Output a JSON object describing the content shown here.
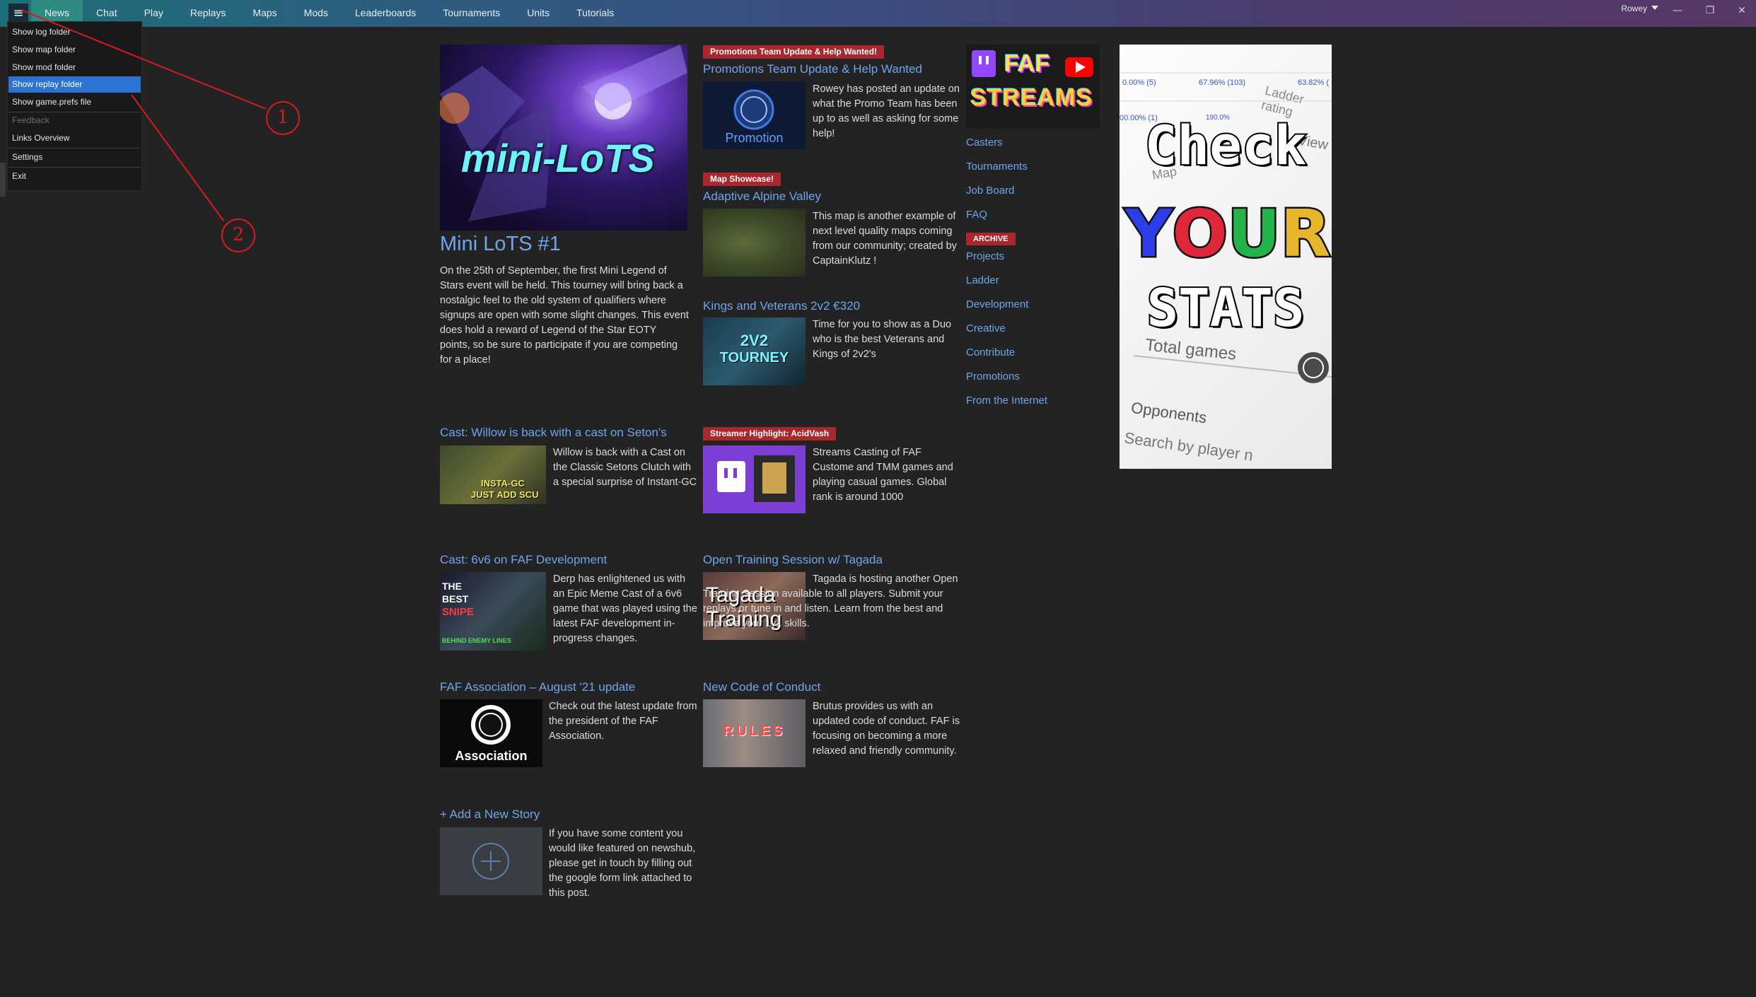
{
  "nav": {
    "menu_icon": "hamburger-icon",
    "menu_glyph": "≡",
    "tabs": [
      "News",
      "Chat",
      "Play",
      "Replays",
      "Maps",
      "Mods",
      "Leaderboards",
      "Tournaments",
      "Units",
      "Tutorials"
    ],
    "active_tab": "News",
    "user": "Rowey",
    "window_controls": {
      "minimize": "—",
      "restore": "❐",
      "close": "✕"
    }
  },
  "dropdown": {
    "items": [
      {
        "label": "Show log folder",
        "state": "normal"
      },
      {
        "label": "Show map folder",
        "state": "normal"
      },
      {
        "label": "Show mod folder",
        "state": "normal"
      },
      {
        "label": "Show replay folder",
        "state": "selected"
      },
      {
        "label": "Show game.prefs file",
        "state": "normal"
      },
      {
        "label": "Feedback",
        "state": "disabled"
      },
      {
        "label": "Links Overview",
        "state": "normal"
      },
      {
        "label": "Settings",
        "state": "normal"
      },
      {
        "label": "Exit",
        "state": "normal"
      }
    ]
  },
  "annotations": [
    "1",
    "2"
  ],
  "hero": {
    "image_text": "mini-LoTS",
    "title": "Mini LoTS #1",
    "text": "On the 25th of September, the first Mini Legend of Stars event will be held. This tourney will bring back a nostalgic feel to the old system of qualifiers where signups are open with some slight changes. This event does hold a reward of Legend of the Star EOTY points, so be sure to participate if you are competing for a place!"
  },
  "articles": {
    "promo": {
      "badge": "Promotions Team Update & Help Wanted!",
      "title": "Promotions Team Update & Help Wanted",
      "thumb_text": "Promotion",
      "text": "Rowey has posted an update on what the Promo Team has been up to as well as asking for some help!"
    },
    "map": {
      "badge": "Map Showcase!",
      "title": "Adaptive Alpine Valley",
      "text": "This map is another example of next level quality maps coming from our community; created by CaptainKlutz !"
    },
    "kings": {
      "title": "Kings and Veterans 2v2 €320",
      "thumb_text_1": "2V2",
      "thumb_text_2": "TOURNEY",
      "text": "Time for you to show as a Duo who is the best Veterans and Kings of 2v2's"
    },
    "willow": {
      "title": "Cast: Willow is back with a cast on Seton's",
      "thumb_text_1": "INSTA-GC",
      "thumb_text_2": "JUST ADD SCU",
      "text": "Willow is back with a Cast on the Classic Setons Clutch with a special surprise of Instant-GC"
    },
    "streamer": {
      "badge": "Streamer Highlight: AcidVash",
      "text": "Streams Casting of FAF Custome and TMM games and playing casual games. Global rank is around 1000"
    },
    "sixv6": {
      "title": "Cast: 6v6 on FAF Development",
      "thumb_text_1": "THE",
      "thumb_text_2": "BEST",
      "thumb_text_3": "SNIPE",
      "thumb_text_4": "BEHIND ENEMY LINES",
      "text": "Derp has enlightened us with an Epic Meme Cast of a 6v6 game that was played using the latest FAF development in-progress changes."
    },
    "tagada": {
      "title": "Open Training Session w/ Tagada",
      "thumb_text_1": "Tagada",
      "thumb_text_2": "Training",
      "text": "Tagada is hosting another Open Training Session available to all players. Submit your replays or tune in and listen. Learn from the best and improve your 1v1 skills."
    },
    "assoc": {
      "title": "FAF Association – August '21 update",
      "thumb_text": "Association",
      "text": "Check out the latest update from the president of the FAF Association."
    },
    "conduct": {
      "title": "New Code of Conduct",
      "thumb_text": "RULES",
      "text": "Brutus provides us with an updated code of conduct. FAF is focusing on becoming a more relaxed and friendly community."
    },
    "add": {
      "title": "+ Add a New Story",
      "text": "If you have some content you would like featured on newshub, please get in touch by filling out the google form link attached to this post."
    }
  },
  "sidebar": {
    "streams_line_1": "FAF",
    "streams_line_2": "STREAMS",
    "links_top": [
      "Casters",
      "Tournaments",
      "Job Board",
      "FAQ"
    ],
    "archive_badge": "ARCHIVE",
    "links_bottom": [
      "Projects",
      "Ladder",
      "Development",
      "Creative",
      "Contribute",
      "Promotions",
      "From the Internet"
    ]
  },
  "stats_banner": {
    "line_1": "Check",
    "line_2": [
      "Y",
      "O",
      "U",
      "R"
    ],
    "line_3": "STATS",
    "bg_texts": [
      "0.00% (5)",
      "67.96% (103)",
      "63.82% (",
      "00.00% (1)",
      "190.0%",
      "Ladder rating",
      "View",
      "Map",
      "Total games",
      "Opponents",
      "Search by player n"
    ]
  },
  "colors": {
    "link": "#6ea5ee",
    "badge": "#a8282e",
    "active_tab": "#2f8a82",
    "selected_item": "#2c73d2",
    "annotation": "#d81a1a"
  }
}
